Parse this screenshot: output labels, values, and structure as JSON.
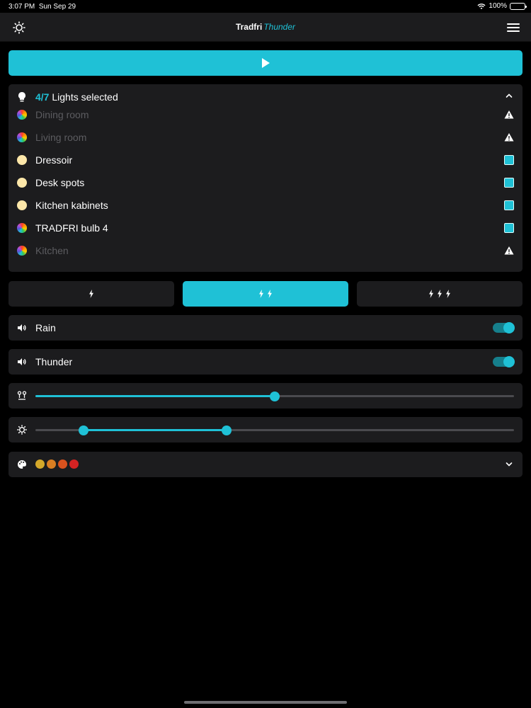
{
  "status_bar": {
    "time": "3:07 PM",
    "date": "Sun Sep 29",
    "battery": "100%",
    "wifi_icon": "wifi-icon",
    "battery_level": 1.0
  },
  "nav": {
    "title_main": "Tradfri",
    "title_accent": "Thunder",
    "left_icon": "brightness-icon",
    "right_icon": "hamburger-menu-icon"
  },
  "play_button": {
    "icon": "play-icon"
  },
  "lights": {
    "selected_count": "4/7",
    "selected_label": "Lights selected",
    "header_icon": "bulb-icon",
    "collapse_icon": "chevron-up-icon",
    "items": [
      {
        "name": "Dining room",
        "type": "color",
        "state": "unreachable"
      },
      {
        "name": "Living room",
        "type": "color",
        "state": "unreachable"
      },
      {
        "name": "Dressoir",
        "type": "white",
        "state": "selected"
      },
      {
        "name": "Desk spots",
        "type": "white",
        "state": "selected"
      },
      {
        "name": "Kitchen kabinets",
        "type": "white",
        "state": "selected"
      },
      {
        "name": "TRADFRI bulb 4",
        "type": "color",
        "state": "selected"
      },
      {
        "name": "Kitchen",
        "type": "color",
        "state": "unreachable"
      }
    ]
  },
  "intensity": {
    "levels": [
      1,
      2,
      3
    ],
    "active": 2,
    "icon": "lightning-bolt-icon"
  },
  "sound": {
    "rain": {
      "label": "Rain",
      "enabled": true,
      "icon": "speaker-icon"
    },
    "thunder": {
      "label": "Thunder",
      "enabled": true,
      "icon": "speaker-icon"
    }
  },
  "frequency_slider": {
    "icon": "frequency-icon",
    "value": 0.5
  },
  "brightness_range": {
    "icon": "brightness-icon",
    "low": 0.1,
    "high": 0.4
  },
  "colors": {
    "icon": "palette-icon",
    "expand_icon": "chevron-down-icon",
    "swatches": [
      "#d4a82a",
      "#d97e22",
      "#d9521e",
      "#d42323"
    ]
  },
  "accent": "#1fc1d6"
}
